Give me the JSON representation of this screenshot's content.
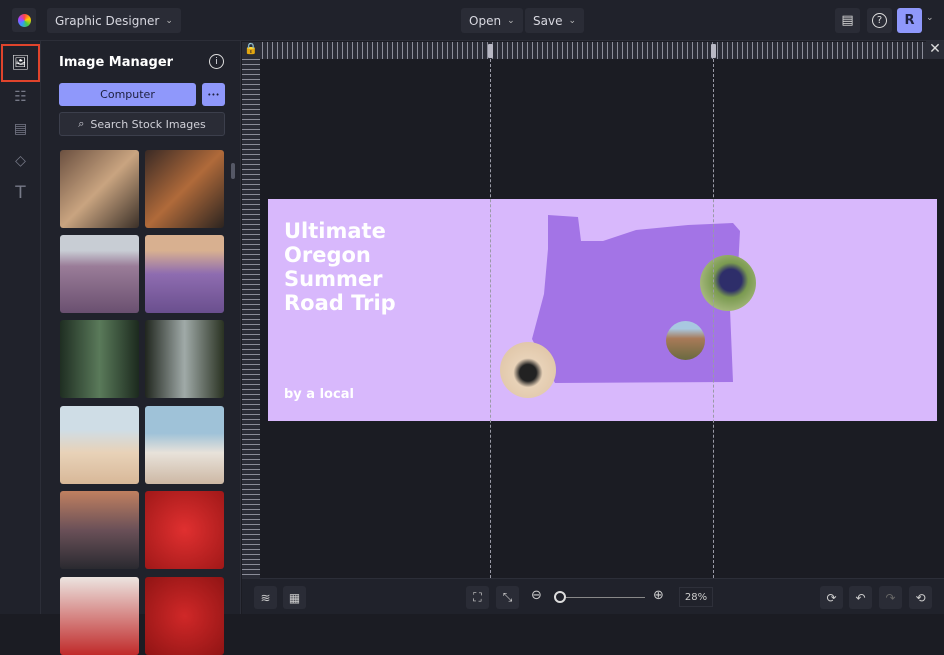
{
  "topbar": {
    "app_mode": "Graphic Designer",
    "open": "Open",
    "save": "Save",
    "avatar": "R"
  },
  "panel": {
    "title": "Image Manager",
    "computer": "Computer",
    "more": "•••",
    "search": "Search Stock Images"
  },
  "design": {
    "title_lines": [
      "Ultimate",
      "Oregon",
      "Summer",
      "Road Trip"
    ],
    "byline": "by a local",
    "bg": "#d8b8fc",
    "map": "#a374e6"
  },
  "bottombar": {
    "zoom": "28%",
    "zoom_fraction": 0.05
  }
}
